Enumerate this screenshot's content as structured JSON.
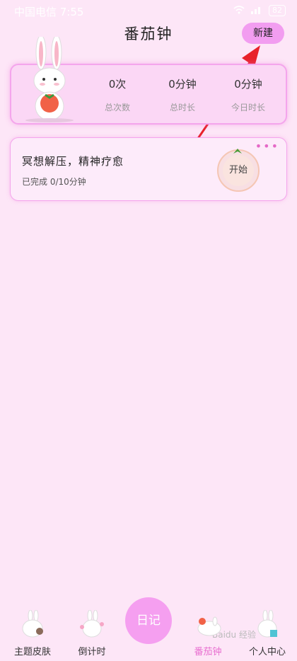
{
  "status": {
    "carrier": "中国电信 7:55",
    "battery": "82"
  },
  "header": {
    "title": "番茄钟",
    "new_button": "新建"
  },
  "stats": [
    {
      "value": "0次",
      "label": "总次数"
    },
    {
      "value": "0分钟",
      "label": "总时长"
    },
    {
      "value": "0分钟",
      "label": "今日时长"
    }
  ],
  "task": {
    "title": "冥想解压，精神疗愈",
    "subtitle": "已完成 0/10分钟",
    "start": "开始",
    "more": "•••"
  },
  "nav": {
    "items": [
      {
        "label": "主题皮肤"
      },
      {
        "label": "倒计时"
      },
      {
        "label": "日记"
      },
      {
        "label": "番茄钟"
      },
      {
        "label": "个人中心"
      }
    ]
  }
}
